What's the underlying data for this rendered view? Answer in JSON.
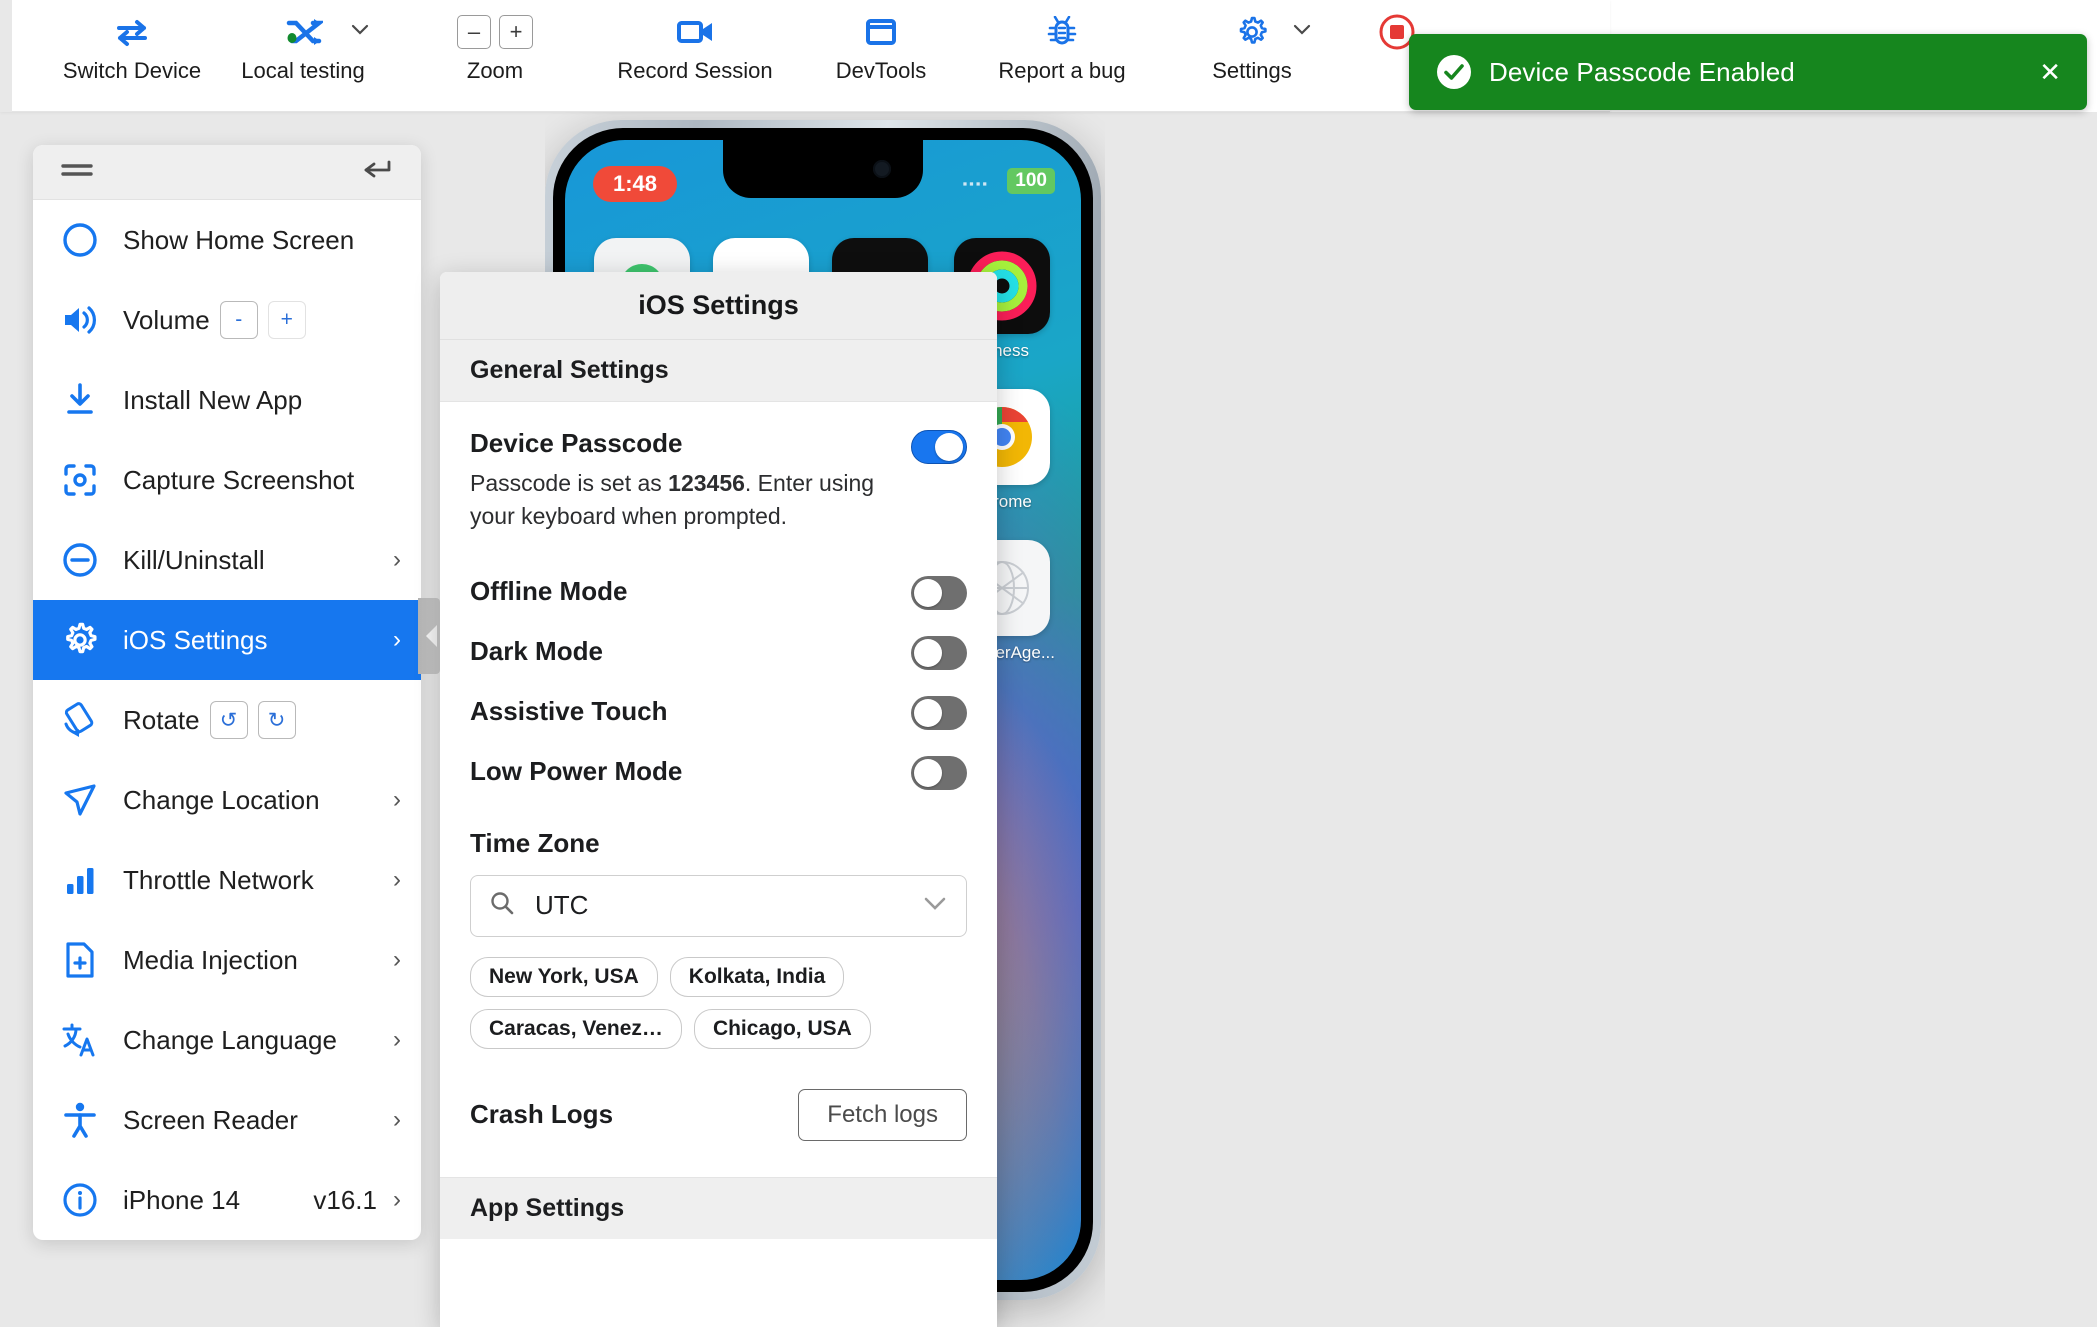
{
  "toolbar": {
    "items": [
      {
        "label": "Switch Device",
        "icon": "switch-device-icon",
        "caret": false
      },
      {
        "label": "Local testing",
        "icon": "local-testing-icon",
        "caret": true
      },
      {
        "label": "Zoom",
        "icon": "zoom-stepper-icon",
        "caret": false,
        "minus": "–",
        "plus": "+"
      },
      {
        "label": "Record Session",
        "icon": "record-session-icon",
        "caret": false
      },
      {
        "label": "DevTools",
        "icon": "devtools-icon",
        "caret": false
      },
      {
        "label": "Report a bug",
        "icon": "bug-icon",
        "caret": false
      },
      {
        "label": "Settings",
        "icon": "gear-icon",
        "caret": true
      },
      {
        "label": "",
        "icon": "stop-session-icon",
        "caret": false
      }
    ]
  },
  "toast": {
    "message": "Device Passcode Enabled",
    "icon": "check-circle-icon",
    "close_label": "✕",
    "color": "#16861e"
  },
  "sidebar": {
    "header": {
      "menu_icon": "hamburger-icon",
      "collapse_icon": "collapse-arrow-icon"
    },
    "items": [
      {
        "label": "Show Home Screen",
        "icon": "home-circle-icon",
        "chevron": false
      },
      {
        "label": "Volume",
        "icon": "volume-icon",
        "chevron": false,
        "buttons": [
          "-",
          "+"
        ]
      },
      {
        "label": "Install New App",
        "icon": "install-app-icon",
        "chevron": false
      },
      {
        "label": "Capture Screenshot",
        "icon": "screenshot-icon",
        "chevron": false
      },
      {
        "label": "Kill/Uninstall",
        "icon": "minus-circle-icon",
        "chevron": true
      },
      {
        "label": "iOS Settings",
        "icon": "gear-icon",
        "chevron": true,
        "active": true
      },
      {
        "label": "Rotate",
        "icon": "rotate-icon",
        "chevron": false,
        "buttons": [
          "↺",
          "↻"
        ]
      },
      {
        "label": "Change Location",
        "icon": "location-arrow-icon",
        "chevron": true
      },
      {
        "label": "Throttle Network",
        "icon": "signal-bars-icon",
        "chevron": true
      },
      {
        "label": "Media Injection",
        "icon": "media-file-plus-icon",
        "chevron": true
      },
      {
        "label": "Change Language",
        "icon": "translate-icon",
        "chevron": true
      },
      {
        "label": "Screen Reader",
        "icon": "accessibility-icon",
        "chevron": true
      },
      {
        "label": "iPhone 14",
        "icon": "info-circle-icon",
        "chevron": true,
        "version": "v16.1"
      }
    ]
  },
  "device": {
    "status_time": "1:48",
    "battery": "100",
    "apps": [
      {
        "name": "",
        "icon": "app-generic-green"
      },
      {
        "name": "",
        "icon": "app-generic-white"
      },
      {
        "name": "",
        "icon": "app-generic-black"
      },
      {
        "name": "Fitness",
        "icon": "fitness-icon"
      },
      {
        "name": "",
        "icon": "app-generic-1"
      },
      {
        "name": "",
        "icon": "app-generic-2"
      },
      {
        "name": "",
        "icon": "app-generic-3"
      },
      {
        "name": "Chrome",
        "icon": "chrome-icon"
      },
      {
        "name": "",
        "icon": "app-generic-4"
      },
      {
        "name": "",
        "icon": "app-generic-5"
      },
      {
        "name": "",
        "icon": "app-generic-6"
      },
      {
        "name": "BrowserAge...",
        "icon": "browserage-icon"
      }
    ]
  },
  "panel": {
    "title": "iOS Settings",
    "sections": {
      "general": "General Settings",
      "app": "App Settings"
    },
    "passcode": {
      "title": "Device Passcode",
      "desc_before": "Passcode is set as ",
      "desc_code": "123456",
      "desc_after": ". Enter using your keyboard when prompted.",
      "enabled": true
    },
    "toggles": [
      {
        "label": "Offline Mode",
        "on": false
      },
      {
        "label": "Dark Mode",
        "on": false
      },
      {
        "label": "Assistive Touch",
        "on": false
      },
      {
        "label": "Low Power Mode",
        "on": false
      }
    ],
    "timezone": {
      "label": "Time Zone",
      "value": "UTC",
      "search_icon": "search-icon",
      "chevron_icon": "chevron-down-icon",
      "chips": [
        "New York, USA",
        "Kolkata, India",
        "Caracas, Venez…",
        "Chicago, USA"
      ]
    },
    "crash_logs": {
      "label": "Crash Logs",
      "button": "Fetch logs"
    }
  },
  "colors": {
    "accent_blue": "#1677ef",
    "toast_green": "#16861e",
    "toggle_on": "#1876ef",
    "toggle_off": "#6f6f6f"
  }
}
